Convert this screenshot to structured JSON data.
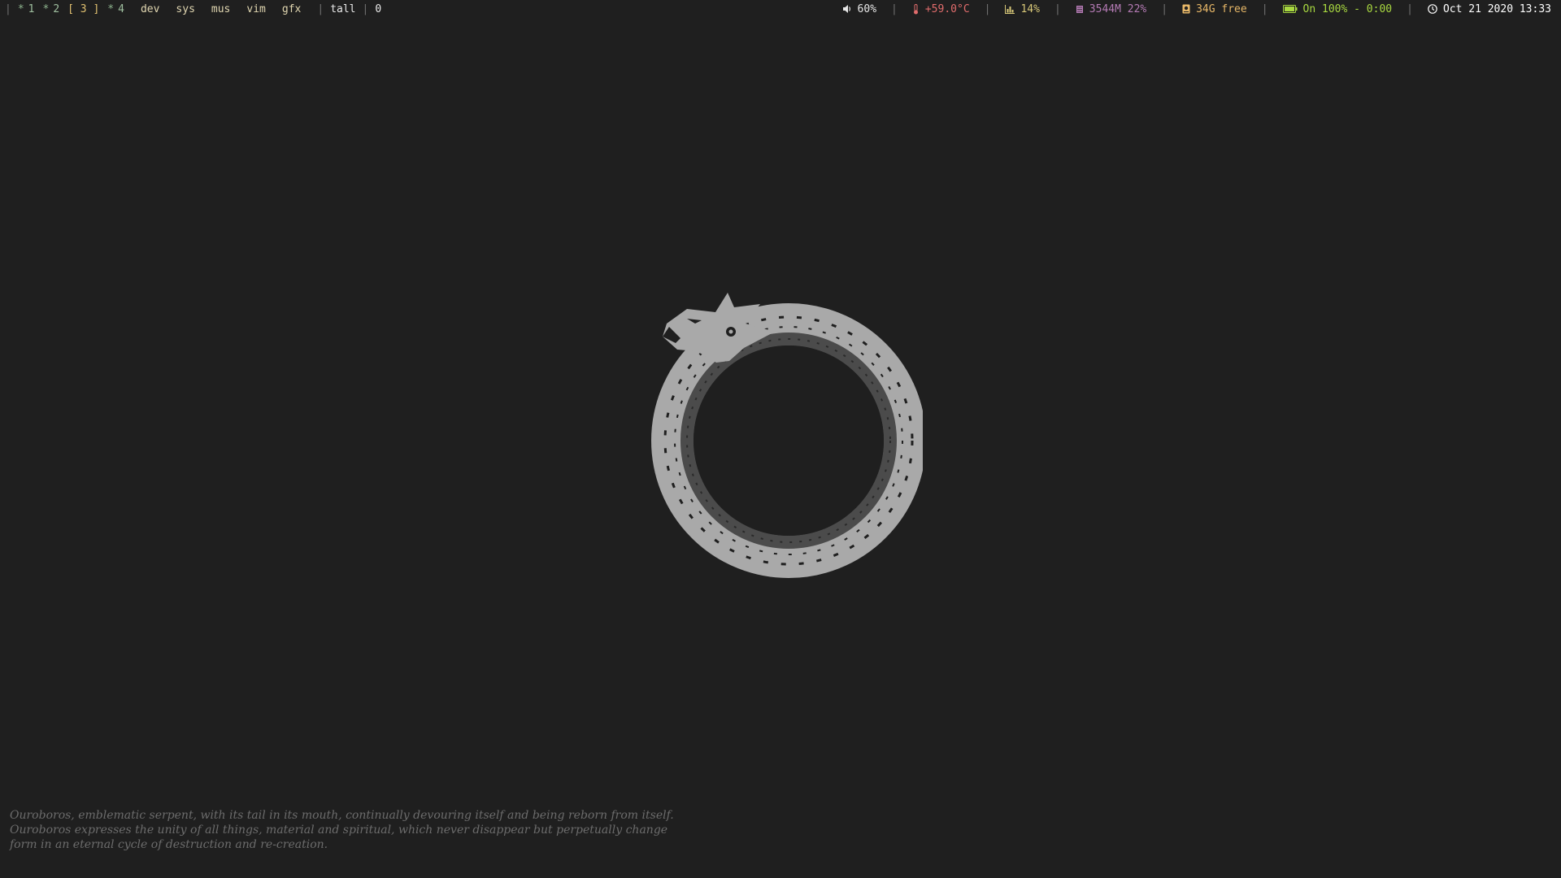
{
  "workspaces": [
    {
      "mark": "*",
      "label": "1",
      "current": false
    },
    {
      "mark": "*",
      "label": "2",
      "current": false
    },
    {
      "mark": "",
      "label": "[ 3 ]",
      "current": true
    },
    {
      "mark": "*",
      "label": "4",
      "current": false
    }
  ],
  "tags": [
    "dev",
    "sys",
    "mus",
    "vim",
    "gfx"
  ],
  "layout": "tall",
  "window_count": "0",
  "status": {
    "volume": {
      "text": "60%",
      "icon": "speaker-icon",
      "color": "#e8e8e8"
    },
    "temperature": {
      "text": "+59.0°C",
      "icon": "thermometer-icon",
      "color": "#e06c6c"
    },
    "cpu": {
      "text": "14%",
      "icon": "bar-chart-icon",
      "color": "#d8c878"
    },
    "memory": {
      "text": "3544M 22%",
      "icon": "memory-chip-icon",
      "color": "#b47ab4"
    },
    "disk": {
      "text": "34G free",
      "icon": "hard-disk-icon",
      "color": "#e8b868"
    },
    "battery": {
      "text": "On 100% - 0:00",
      "icon": "battery-icon",
      "color": "#a8d840"
    },
    "clock": {
      "text": "Oct 21 2020 13:33",
      "icon": "clock-icon",
      "color": "#ffffff"
    }
  },
  "wallpaper": {
    "image": "ouroboros-dragon",
    "quote_lines": [
      "Ouroboros, emblematic serpent, with its tail in its mouth, continually devouring itself and being reborn from itself.",
      "Ouroboros expresses the unity of all things, material and spiritual, which never disappear but perpetually change",
      "form in an eternal cycle of destruction and re-creation."
    ]
  }
}
